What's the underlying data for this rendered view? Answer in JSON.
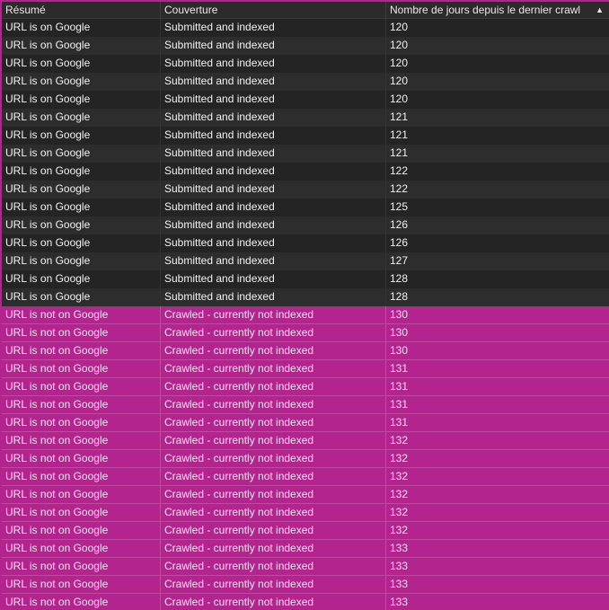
{
  "table": {
    "columns": [
      "Résumé",
      "Couverture",
      "Nombre de jours depuis le dernier crawl"
    ],
    "sort_indicator": "▲",
    "rows": [
      {
        "summary": "URL is on Google",
        "coverage": "Submitted and indexed",
        "days": "120",
        "status": "indexed"
      },
      {
        "summary": "URL is on Google",
        "coverage": "Submitted and indexed",
        "days": "120",
        "status": "indexed"
      },
      {
        "summary": "URL is on Google",
        "coverage": "Submitted and indexed",
        "days": "120",
        "status": "indexed"
      },
      {
        "summary": "URL is on Google",
        "coverage": "Submitted and indexed",
        "days": "120",
        "status": "indexed"
      },
      {
        "summary": "URL is on Google",
        "coverage": "Submitted and indexed",
        "days": "120",
        "status": "indexed"
      },
      {
        "summary": "URL is on Google",
        "coverage": "Submitted and indexed",
        "days": "121",
        "status": "indexed"
      },
      {
        "summary": "URL is on Google",
        "coverage": "Submitted and indexed",
        "days": "121",
        "status": "indexed"
      },
      {
        "summary": "URL is on Google",
        "coverage": "Submitted and indexed",
        "days": "121",
        "status": "indexed"
      },
      {
        "summary": "URL is on Google",
        "coverage": "Submitted and indexed",
        "days": "122",
        "status": "indexed"
      },
      {
        "summary": "URL is on Google",
        "coverage": "Submitted and indexed",
        "days": "122",
        "status": "indexed"
      },
      {
        "summary": "URL is on Google",
        "coverage": "Submitted and indexed",
        "days": "125",
        "status": "indexed"
      },
      {
        "summary": "URL is on Google",
        "coverage": "Submitted and indexed",
        "days": "126",
        "status": "indexed"
      },
      {
        "summary": "URL is on Google",
        "coverage": "Submitted and indexed",
        "days": "126",
        "status": "indexed"
      },
      {
        "summary": "URL is on Google",
        "coverage": "Submitted and indexed",
        "days": "127",
        "status": "indexed"
      },
      {
        "summary": "URL is on Google",
        "coverage": "Submitted and indexed",
        "days": "128",
        "status": "indexed"
      },
      {
        "summary": "URL is on Google",
        "coverage": "Submitted and indexed",
        "days": "128",
        "status": "indexed"
      },
      {
        "summary": "URL is not on Google",
        "coverage": "Crawled - currently not indexed",
        "days": "130",
        "status": "notindexed"
      },
      {
        "summary": "URL is not on Google",
        "coverage": "Crawled - currently not indexed",
        "days": "130",
        "status": "notindexed"
      },
      {
        "summary": "URL is not on Google",
        "coverage": "Crawled - currently not indexed",
        "days": "130",
        "status": "notindexed"
      },
      {
        "summary": "URL is not on Google",
        "coverage": "Crawled - currently not indexed",
        "days": "131",
        "status": "notindexed"
      },
      {
        "summary": "URL is not on Google",
        "coverage": "Crawled - currently not indexed",
        "days": "131",
        "status": "notindexed"
      },
      {
        "summary": "URL is not on Google",
        "coverage": "Crawled - currently not indexed",
        "days": "131",
        "status": "notindexed"
      },
      {
        "summary": "URL is not on Google",
        "coverage": "Crawled - currently not indexed",
        "days": "131",
        "status": "notindexed"
      },
      {
        "summary": "URL is not on Google",
        "coverage": "Crawled - currently not indexed",
        "days": "132",
        "status": "notindexed"
      },
      {
        "summary": "URL is not on Google",
        "coverage": "Crawled - currently not indexed",
        "days": "132",
        "status": "notindexed"
      },
      {
        "summary": "URL is not on Google",
        "coverage": "Crawled - currently not indexed",
        "days": "132",
        "status": "notindexed"
      },
      {
        "summary": "URL is not on Google",
        "coverage": "Crawled - currently not indexed",
        "days": "132",
        "status": "notindexed"
      },
      {
        "summary": "URL is not on Google",
        "coverage": "Crawled - currently not indexed",
        "days": "132",
        "status": "notindexed"
      },
      {
        "summary": "URL is not on Google",
        "coverage": "Crawled - currently not indexed",
        "days": "132",
        "status": "notindexed"
      },
      {
        "summary": "URL is not on Google",
        "coverage": "Crawled - currently not indexed",
        "days": "133",
        "status": "notindexed"
      },
      {
        "summary": "URL is not on Google",
        "coverage": "Crawled - currently not indexed",
        "days": "133",
        "status": "notindexed"
      },
      {
        "summary": "URL is not on Google",
        "coverage": "Crawled - currently not indexed",
        "days": "133",
        "status": "notindexed"
      },
      {
        "summary": "URL is not on Google",
        "coverage": "Crawled - currently not indexed",
        "days": "133",
        "status": "notindexed"
      }
    ]
  },
  "colors": {
    "highlight": "#b3248f",
    "row_dark": "#242424",
    "row_light": "#2d2d2d",
    "header_bg": "#2b2b2b"
  }
}
